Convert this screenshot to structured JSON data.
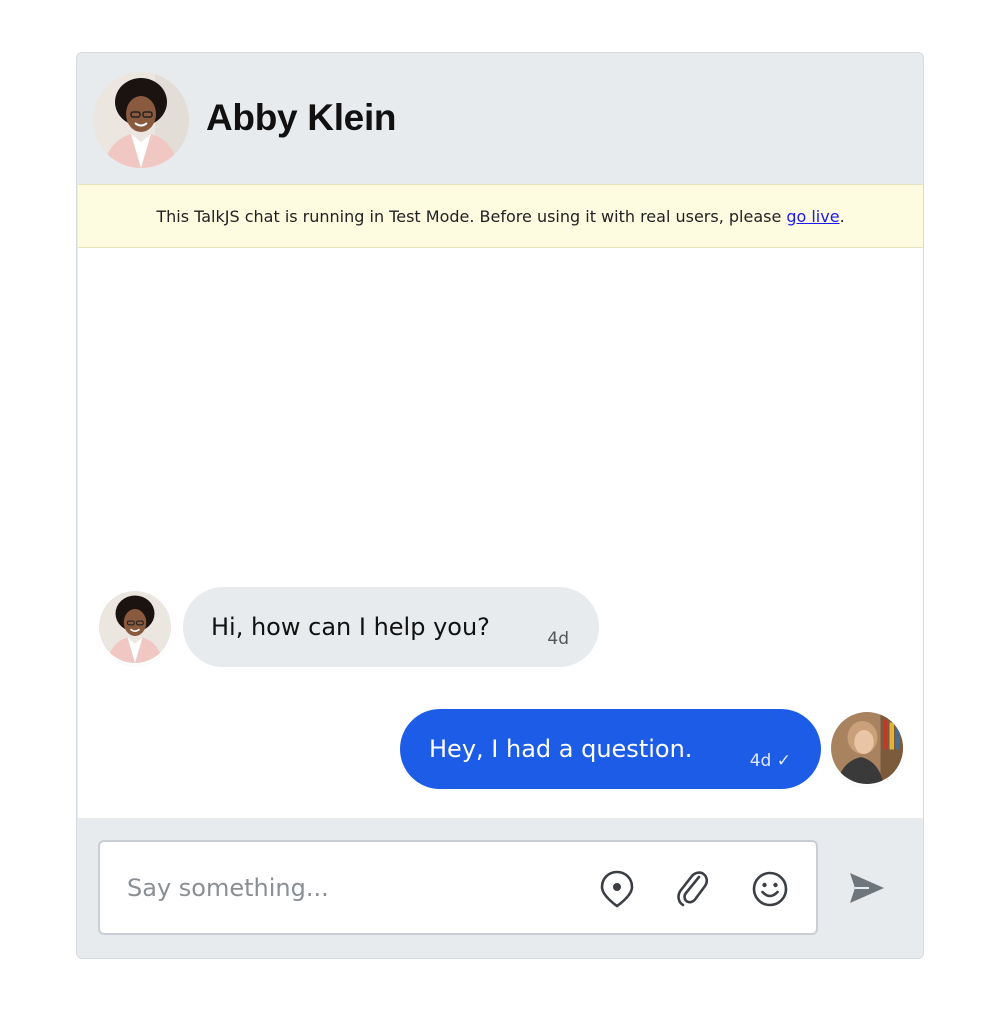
{
  "header": {
    "title": "Abby Klein"
  },
  "banner": {
    "text": "This TalkJS chat is running in Test Mode. Before using it with real users, please",
    "link_label": "go live",
    "trailing": "."
  },
  "messages": [
    {
      "direction": "incoming",
      "text": "Hi, how can I help you?",
      "time": "4d"
    },
    {
      "direction": "outgoing",
      "text": "Hey, I had a question.",
      "time": "4d ✓"
    }
  ],
  "composer": {
    "placeholder": "Say something..."
  },
  "icons": {
    "location": "location-pin-icon",
    "attach": "paperclip-icon",
    "emoji": "smiley-icon",
    "send": "send-arrow-icon"
  },
  "colors": {
    "accent": "#1d5ce6",
    "panel": "#e7ebee",
    "banner_bg": "#fdfbe0",
    "link": "#1a1aee"
  }
}
